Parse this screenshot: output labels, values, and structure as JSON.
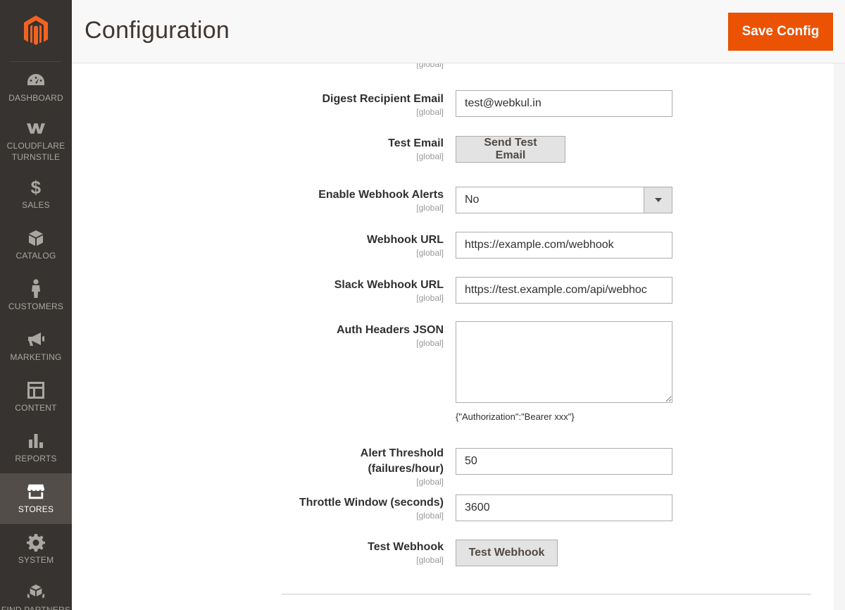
{
  "header": {
    "title": "Configuration",
    "save_label": "Save Config"
  },
  "sidebar": {
    "items": [
      {
        "label": "DASHBOARD",
        "icon": "dashboard-icon"
      },
      {
        "label": "CLOUDFLARE TURNSTILE",
        "icon": "cloudflare-icon"
      },
      {
        "label": "SALES",
        "icon": "dollar-icon"
      },
      {
        "label": "CATALOG",
        "icon": "box-icon"
      },
      {
        "label": "CUSTOMERS",
        "icon": "person-icon"
      },
      {
        "label": "MARKETING",
        "icon": "megaphone-icon"
      },
      {
        "label": "CONTENT",
        "icon": "layout-icon"
      },
      {
        "label": "REPORTS",
        "icon": "bar-chart-icon"
      },
      {
        "label": "STORES",
        "icon": "store-icon",
        "active": true
      },
      {
        "label": "SYSTEM",
        "icon": "gear-icon"
      },
      {
        "label": "FIND PARTNERS",
        "icon": "cubes-icon"
      }
    ]
  },
  "form": {
    "scope": "[global]",
    "digest_email": {
      "label": "Digest Recipient Email",
      "value": "test@webkul.in"
    },
    "test_email": {
      "label": "Test Email",
      "button": "Send Test Email"
    },
    "webhook_alerts": {
      "label": "Enable Webhook Alerts",
      "value": "No"
    },
    "webhook_url": {
      "label": "Webhook URL",
      "value": "https://example.com/webhook"
    },
    "slack_url": {
      "label": "Slack Webhook URL",
      "value": "https://test.example.com/api/webhoc"
    },
    "auth_headers": {
      "label": "Auth Headers JSON",
      "value": "",
      "note": "{\"Authorization\":\"Bearer xxx\"}"
    },
    "alert_threshold": {
      "label_line1": "Alert Threshold",
      "label_line2": "(failures/hour)",
      "value": "50"
    },
    "throttle_window": {
      "label": "Throttle Window (seconds)",
      "value": "3600"
    },
    "test_webhook": {
      "label": "Test Webhook",
      "button": "Test Webhook"
    }
  },
  "colors": {
    "sidebar_bg": "#373330",
    "active_bg": "#524d49",
    "accent": "#eb5202"
  }
}
